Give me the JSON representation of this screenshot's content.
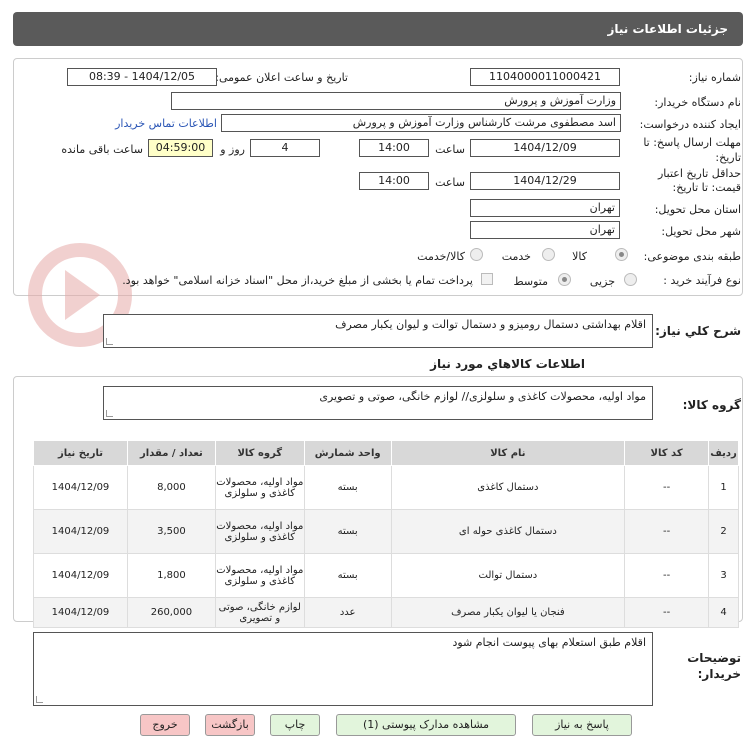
{
  "header": {
    "title": "جزئیات اطلاعات نیاز"
  },
  "form": {
    "need_number_label": "شماره نیاز:",
    "need_number": "1104000011000421",
    "announce_label": "تاریخ و ساعت اعلان عمومی:",
    "announce_value": "1404/12/05 - 08:39",
    "buyer_org_label": "نام دستگاه خریدار:",
    "buyer_org": "وزارت آموزش و پرورش",
    "requester_label": "ایجاد کننده درخواست:",
    "requester": "اسد مصطفوی مرشت کارشناس وزارت آموزش و پرورش",
    "contact_link": "اطلاعات تماس خریدار",
    "deadline_label_1": "مهلت ارسال پاسخ: تا",
    "deadline_label_2": "تاریخ:",
    "deadline_date": "1404/12/09",
    "time_label": "ساعت",
    "deadline_time": "14:00",
    "days_value": "4",
    "days_label": "روز و",
    "remaining_value": "04:59:00",
    "remaining_label": "ساعت باقی مانده",
    "validity_label_1": "حداقل تاریخ اعتبار",
    "validity_label_2": "قیمت: تا تاریخ:",
    "validity_date": "1404/12/29",
    "validity_time": "14:00",
    "province_label": "استان محل تحویل:",
    "province": "تهران",
    "city_label": "شهر محل تحویل:",
    "city": "تهران",
    "category_label": "طبقه بندی موضوعی:",
    "category_options": [
      "کالا",
      "خدمت",
      "کالا/خدمت"
    ],
    "process_label": "نوع فرآیند خرید :",
    "process_options": [
      "جزیی",
      "متوسط"
    ],
    "payment_note": "پرداخت تمام یا بخشی از مبلغ خرید،از محل \"اسناد خزانه اسلامی\" خواهد بود."
  },
  "summary": {
    "label": "شرح كلي نياز:",
    "value": "اقلام بهداشتی دستمال رومیزو و دستمال توالت و لیوان یکبار مصرف"
  },
  "goods_info": {
    "title": "اطلاعات كالاهاي مورد نياز",
    "group_label": "گروه كالا:",
    "group_value": "مواد اولیه، محصولات کاغذی و سلولزی// لوازم خانگی، صوتی و تصویری"
  },
  "table": {
    "headers": [
      "رديف",
      "كد كالا",
      "نام كالا",
      "واحد شمارش",
      "گروه كالا",
      "تعداد / مقدار",
      "تاريخ نياز"
    ],
    "rows": [
      {
        "idx": "1",
        "code": "--",
        "name": "دستمال کاغذی",
        "unit": "بسته",
        "group": "مواد اولیه، محصولات کاغذی و سلولزی",
        "qty": "8,000",
        "date": "1404/12/09"
      },
      {
        "idx": "2",
        "code": "--",
        "name": "دستمال کاغذی حوله ای",
        "unit": "بسته",
        "group": "مواد اولیه، محصولات کاغذی و سلولزی",
        "qty": "3,500",
        "date": "1404/12/09"
      },
      {
        "idx": "3",
        "code": "--",
        "name": "دستمال توالت",
        "unit": "بسته",
        "group": "مواد اولیه، محصولات کاغذی و سلولزی",
        "qty": "1,800",
        "date": "1404/12/09"
      },
      {
        "idx": "4",
        "code": "--",
        "name": "فنجان یا لیوان یکبار مصرف",
        "unit": "عدد",
        "group": "لوازم خانگی، صوتی و تصویری",
        "qty": "260,000",
        "date": "1404/12/09"
      }
    ]
  },
  "notes": {
    "label_1": "توضیحات",
    "label_2": "خریدار:",
    "value": "اقلام طبق استعلام بهای پیوست انجام شود"
  },
  "buttons": {
    "respond": "پاسخ به نیاز",
    "attachments": "مشاهده مدارک پیوستی (1)",
    "print": "چاپ",
    "back": "بازگشت",
    "exit": "خروج"
  },
  "colors": {
    "header": "#5a5a5a",
    "watermark": "#d9534f",
    "button_green": "#e2f5dc",
    "button_pink": "#f7c6c6"
  }
}
